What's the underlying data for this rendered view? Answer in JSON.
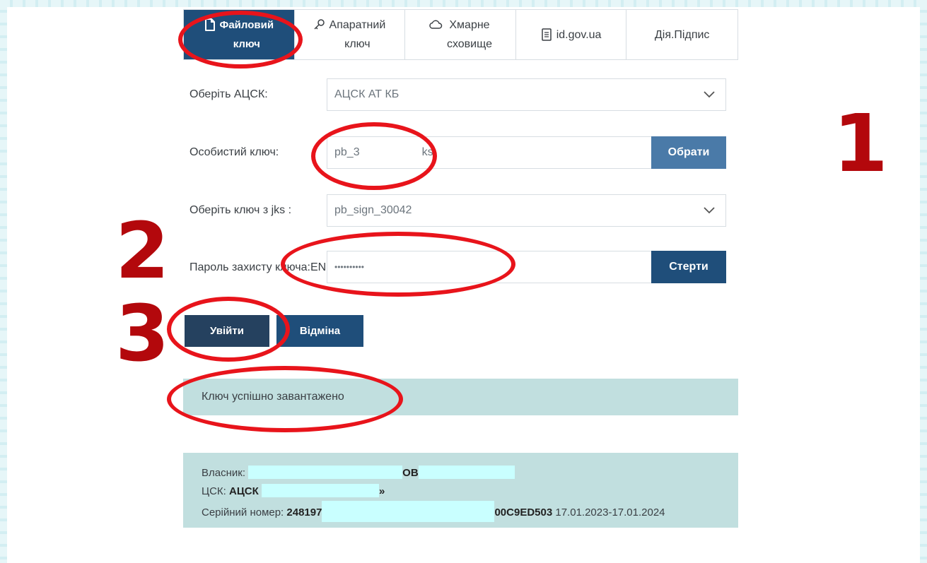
{
  "tabs": [
    {
      "line1": "Файловий",
      "line2": "ключ",
      "icon": "file-icon",
      "active": true
    },
    {
      "line1": "Апаратний",
      "line2": "ключ",
      "icon": "key-icon",
      "active": false
    },
    {
      "line1": "Хмарне",
      "line2": "сховище",
      "icon": "cloud-icon",
      "active": false
    },
    {
      "line1": "id.gov.ua",
      "line2": "",
      "icon": "document-icon",
      "active": false
    },
    {
      "line1": "Дія.Підпис",
      "line2": "",
      "icon": "",
      "active": false
    }
  ],
  "form": {
    "acsk_label": "Оберіть АЦСК:",
    "acsk_value": "АЦСК АТ КБ",
    "key_label": "Особистий ключ:",
    "key_value_start": "pb_3",
    "key_value_end": "ks",
    "choose_button": "Обрати",
    "jks_label": "Оберіть ключ з jks :",
    "jks_value": "pb_sign_30042",
    "password_label": "Пароль захисту ключа:",
    "password_lang": "EN",
    "password_value": "••••••••••",
    "clear_button": "Стерти",
    "login_button": "Увійти",
    "cancel_button": "Відміна"
  },
  "status": {
    "message": "Ключ успішно завантажено"
  },
  "cert_info": {
    "owner_label": "Власник:",
    "owner_tail": "ОВ",
    "csk_label": "ЦСК:",
    "csk_value": "АЦСК",
    "csk_tail": "»",
    "serial_label": "Серійний номер:",
    "serial_start": "248197",
    "serial_end": "00C9ED503",
    "validity": "17.01.2023-17.01.2024"
  },
  "annotations": {
    "step1": "1",
    "step2": "2",
    "step3": "3",
    "highlight_color": "#e8141b",
    "number_color": "#b3080c"
  },
  "colors": {
    "primary": "#1f4e7a",
    "choose_button": "#4a7aa8",
    "login_button": "#25415f",
    "alert_bg": "#c1dfdf",
    "redaction": "#c9ffff"
  }
}
